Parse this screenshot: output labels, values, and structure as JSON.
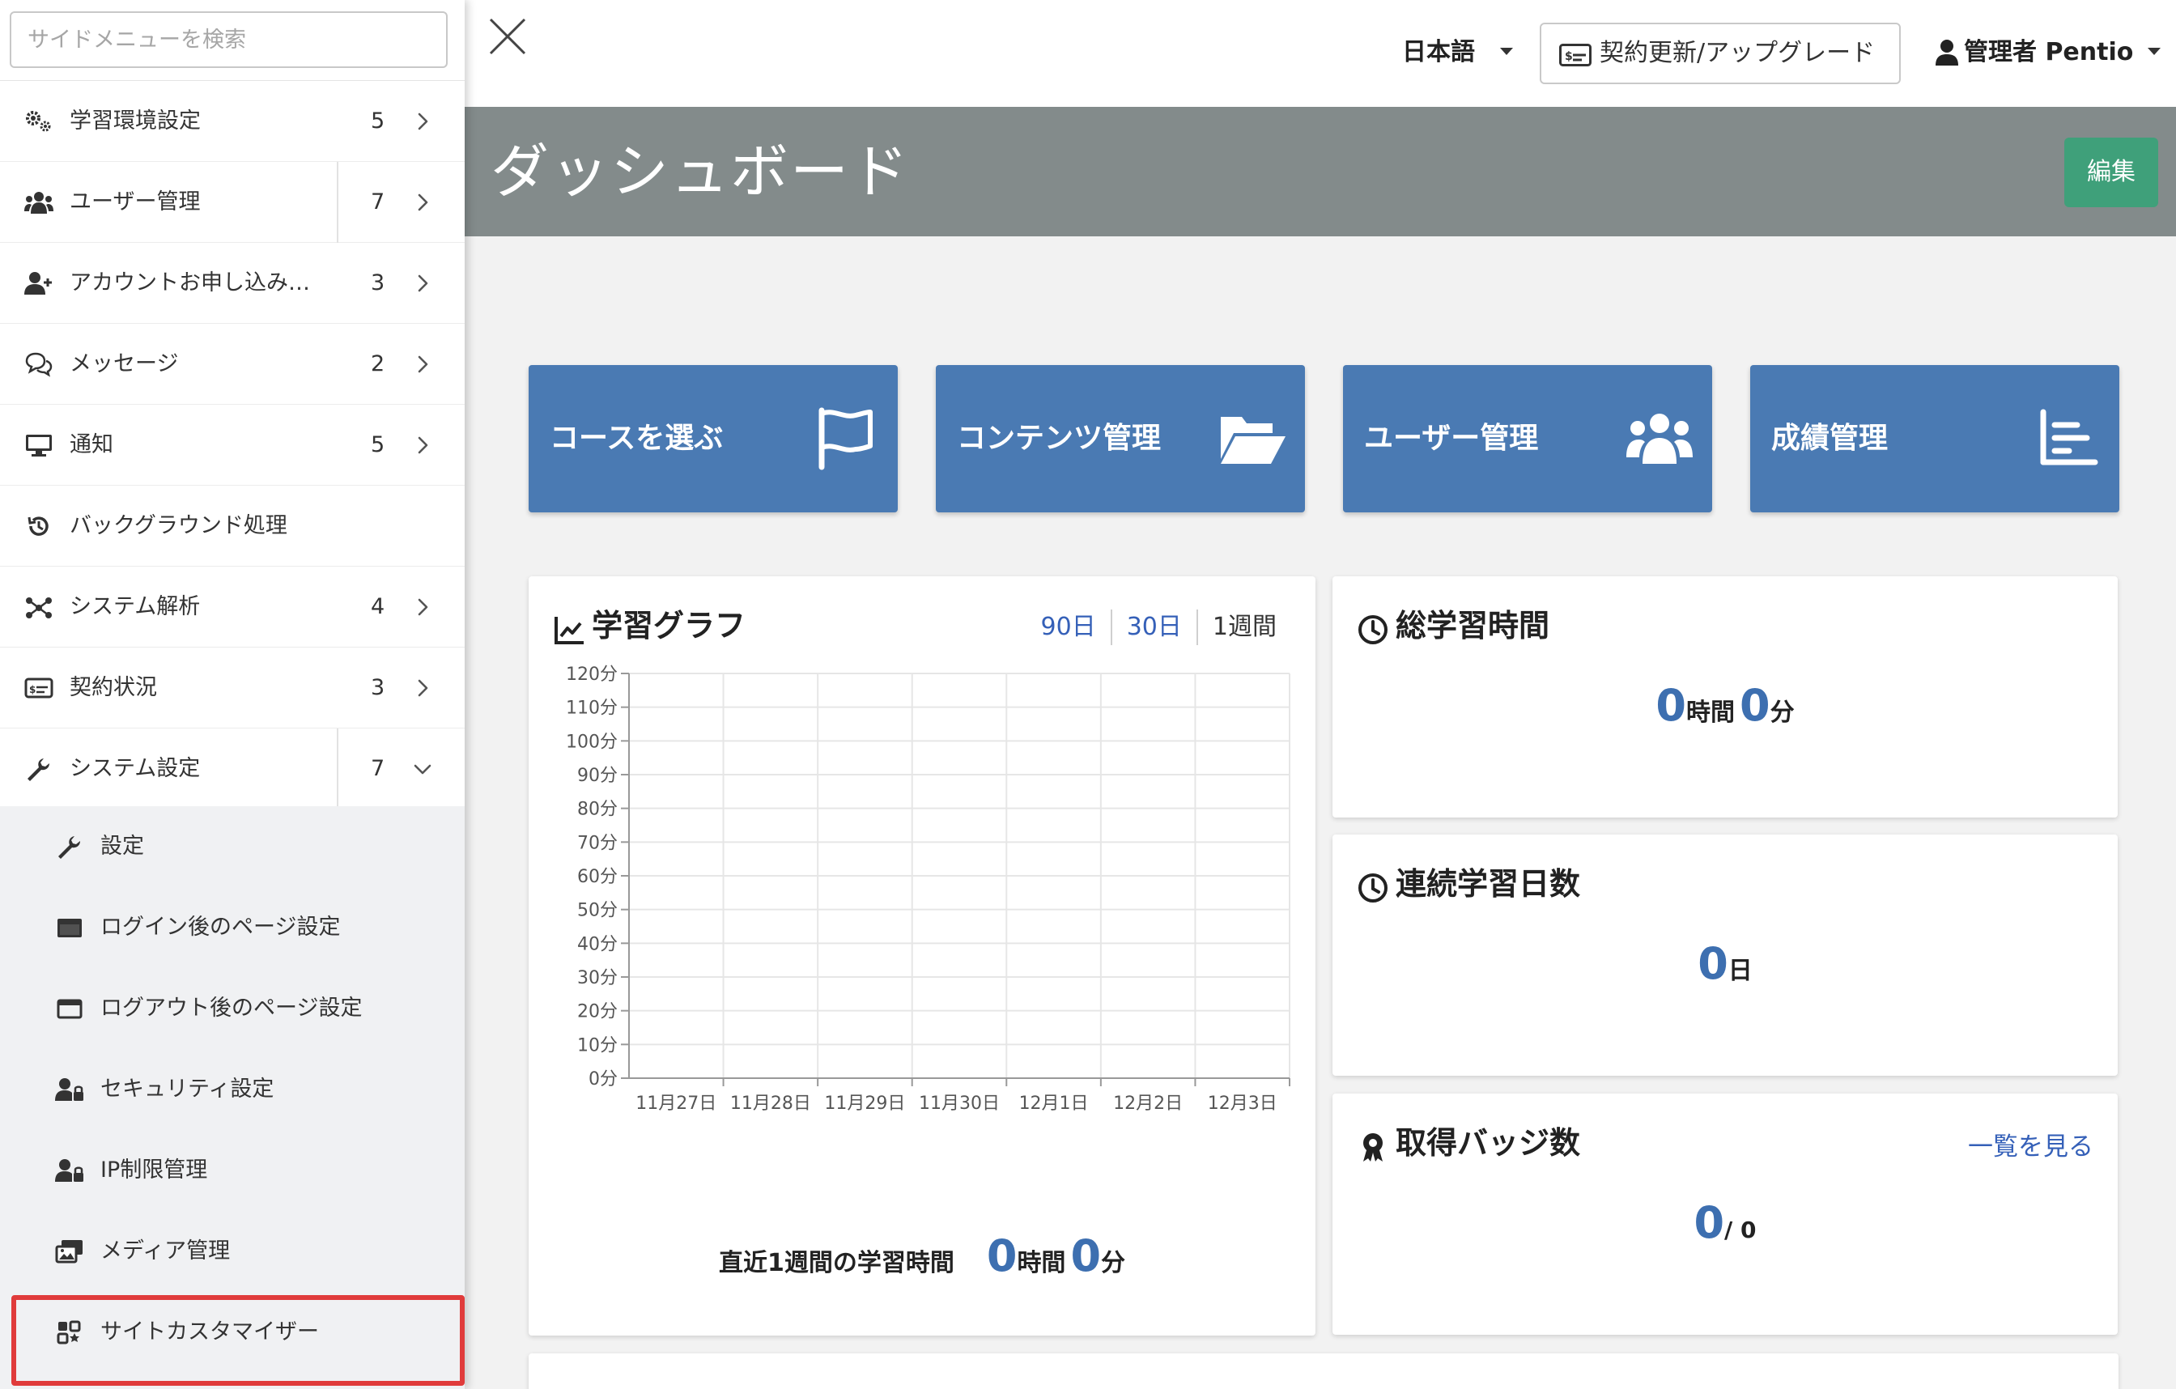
{
  "sidebar": {
    "search_placeholder": "サイドメニューを検索",
    "items": [
      {
        "label": "学習環境設定",
        "count": "5",
        "icon": "gears-icon",
        "expanded": false,
        "separator": false
      },
      {
        "label": "ユーザー管理",
        "count": "7",
        "icon": "users-icon",
        "expanded": false,
        "separator": true
      },
      {
        "label": "アカウントお申し込み承認",
        "count": "3",
        "icon": "user-plus-icon",
        "expanded": false,
        "separator": false
      },
      {
        "label": "メッセージ",
        "count": "2",
        "icon": "comments-icon",
        "expanded": false,
        "separator": false
      },
      {
        "label": "通知",
        "count": "5",
        "icon": "desktop-icon",
        "expanded": false,
        "separator": false
      },
      {
        "label": "バックグラウンド処理",
        "count": "",
        "icon": "history-icon",
        "expanded": false,
        "separator": false
      },
      {
        "label": "システム解析",
        "count": "4",
        "icon": "network-icon",
        "expanded": false,
        "separator": false
      },
      {
        "label": "契約状況",
        "count": "3",
        "icon": "credit-card-icon",
        "expanded": false,
        "separator": false
      },
      {
        "label": "システム設定",
        "count": "7",
        "icon": "wrench-icon",
        "expanded": true,
        "separator": true
      }
    ],
    "submenu": [
      {
        "label": "設定",
        "icon": "wrench-icon"
      },
      {
        "label": "ログイン後のページ設定",
        "icon": "browser-window-icon"
      },
      {
        "label": "ログアウト後のページ設定",
        "icon": "browser-window-outline-icon"
      },
      {
        "label": "セキュリティ設定",
        "icon": "user-lock-icon"
      },
      {
        "label": "IP制限管理",
        "icon": "user-lock-icon"
      },
      {
        "label": "メディア管理",
        "icon": "photo-video-icon"
      },
      {
        "label": "サイトカスタマイザー",
        "icon": "customizer-icon",
        "highlighted": true
      }
    ]
  },
  "topbar": {
    "language": "日本語",
    "upgrade_label": "契約更新/アップグレード",
    "user_label": "管理者 Pentio"
  },
  "header": {
    "title": "ダッシュボード",
    "edit_label": "編集",
    "header_color": "#838b8b",
    "edit_color": "#3fa07a"
  },
  "shortcuts": [
    {
      "label": "コースを選ぶ",
      "icon": "flag-icon"
    },
    {
      "label": "コンテンツ管理",
      "icon": "folder-open-icon"
    },
    {
      "label": "ユーザー管理",
      "icon": "users-icon"
    },
    {
      "label": "成績管理",
      "icon": "bar-chart-icon"
    }
  ],
  "learning_graph": {
    "title": "学習グラフ",
    "ranges": [
      "90日",
      "30日",
      "1週間"
    ],
    "active_range": "1週間",
    "summary_label": "直近1週間の学習時間",
    "summary_hours": "0",
    "summary_hours_unit": "時間",
    "summary_minutes": "0",
    "summary_minutes_unit": "分"
  },
  "chart_data": {
    "type": "line",
    "categories": [
      "11月27日",
      "11月28日",
      "11月29日",
      "11月30日",
      "12月1日",
      "12月2日",
      "12月3日"
    ],
    "y_ticks": [
      "120分",
      "110分",
      "100分",
      "90分",
      "80分",
      "70分",
      "60分",
      "50分",
      "40分",
      "30分",
      "20分",
      "10分",
      "0分"
    ],
    "ylim": [
      0,
      120
    ],
    "series": [],
    "grid": true,
    "xlabel": "",
    "ylabel": ""
  },
  "total_time": {
    "title": "総学習時間",
    "hours": "0",
    "hours_unit": "時間",
    "minutes": "0",
    "minutes_unit": "分"
  },
  "streak": {
    "title": "連続学習日数",
    "days": "0",
    "days_unit": "日"
  },
  "badges": {
    "title": "取得バッジ数",
    "see_all": "一覧を見る",
    "earned": "0",
    "total_text": "/ 0"
  },
  "colors": {
    "accent_blue": "#4a7ab3",
    "link_blue": "#3560b8",
    "number_blue": "#3d6fb0",
    "highlight_red": "#e03b3b"
  }
}
